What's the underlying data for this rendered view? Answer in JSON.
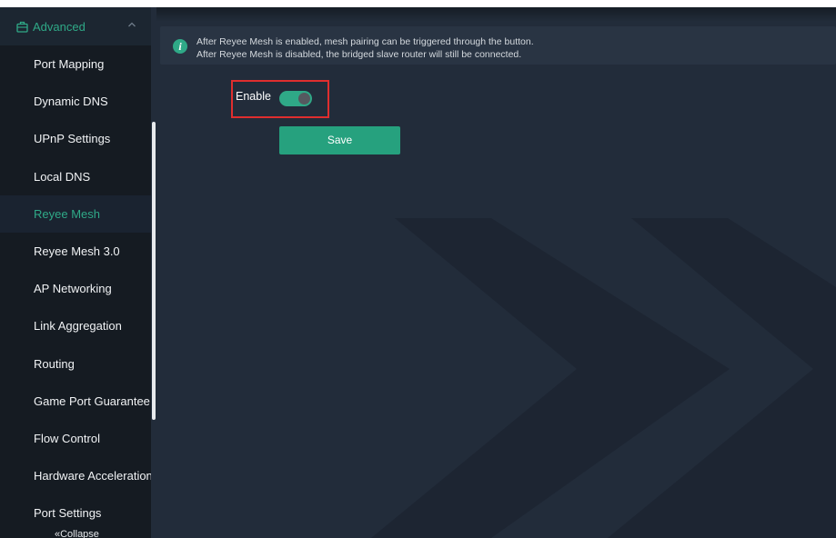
{
  "sidebar": {
    "section_label": "Advanced",
    "section_icon": "briefcase-icon",
    "items": [
      {
        "label": "Port Mapping",
        "active": false
      },
      {
        "label": "Dynamic DNS",
        "active": false
      },
      {
        "label": "UPnP Settings",
        "active": false
      },
      {
        "label": "Local DNS",
        "active": false
      },
      {
        "label": "Reyee Mesh",
        "active": true
      },
      {
        "label": "Reyee Mesh 3.0",
        "active": false
      },
      {
        "label": "AP Networking",
        "active": false
      },
      {
        "label": "Link Aggregation",
        "active": false
      },
      {
        "label": "Routing",
        "active": false
      },
      {
        "label": "Game Port Guarantee",
        "active": false
      },
      {
        "label": "Flow Control",
        "active": false
      },
      {
        "label": "Hardware Acceleration",
        "active": false
      },
      {
        "label": "Port Settings",
        "active": false
      }
    ],
    "collapse_label": "«Collapse"
  },
  "main": {
    "info": {
      "icon": "info-icon",
      "line1": "After Reyee Mesh is enabled, mesh pairing can be triggered through the button.",
      "line2": "After Reyee Mesh is disabled, the bridged slave router will still be connected."
    },
    "enable_label": "Enable",
    "enable_state": true,
    "save_label": "Save"
  },
  "colors": {
    "accent": "#2fa987",
    "sidebar_bg": "#151b22",
    "main_bg": "#222c3a",
    "highlight_box": "#e02e2e"
  }
}
